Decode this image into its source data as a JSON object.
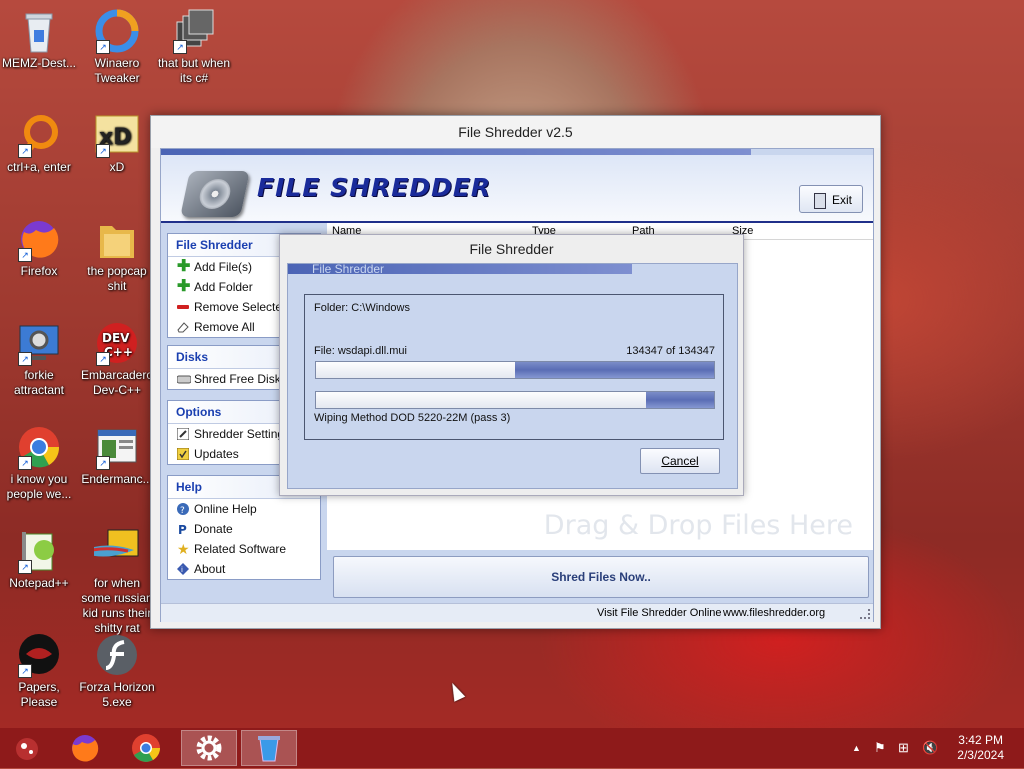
{
  "desktop": {
    "icons": [
      {
        "label": "MEMZ-Dest...",
        "icon": "recycle-bin-icon"
      },
      {
        "label": "Winaero Tweaker",
        "icon": "winaero-icon"
      },
      {
        "label": "that but when its c#",
        "icon": "stacked-windows-icon"
      },
      {
        "label": "ctrl+a, enter",
        "icon": "orange-ring-icon"
      },
      {
        "label": "xD",
        "icon": "hxd-icon"
      },
      {
        "label": "Firefox",
        "icon": "firefox-icon"
      },
      {
        "label": "the popcap shit",
        "icon": "folder-icon"
      },
      {
        "label": "forkie attractant",
        "icon": "monitor-gear-icon"
      },
      {
        "label": "Embarcadero Dev-C++",
        "icon": "devcpp-icon"
      },
      {
        "label": "i know you people we...",
        "icon": "chrome-icon"
      },
      {
        "label": "Endermanc...",
        "icon": "document-window-icon"
      },
      {
        "label": "Notepad++",
        "icon": "notepadpp-icon"
      },
      {
        "label": "for when some russian kid runs their shitty rat",
        "icon": "fish-icon"
      },
      {
        "label": "Papers, Please",
        "icon": "papers-please-icon"
      },
      {
        "label": "Forza Horizon 5.exe",
        "icon": "flash-icon"
      }
    ]
  },
  "main_window": {
    "title": "File Shredder v2.5",
    "old_title": "File Shredder v2.5",
    "logo": "FILE SHREDDER",
    "exit_label": "Exit",
    "sections": [
      {
        "header": "File Shredder",
        "items": [
          {
            "label": "Add File(s)",
            "icon": "plus-icon"
          },
          {
            "label": "Add Folder",
            "icon": "plus-icon"
          },
          {
            "label": "Remove Selected",
            "icon": "minus-icon"
          },
          {
            "label": "Remove All",
            "icon": "eraser-icon"
          }
        ]
      },
      {
        "header": "Disks",
        "items": [
          {
            "label": "Shred Free Disk Space",
            "icon": "disk-icon"
          }
        ]
      },
      {
        "header": "Options",
        "items": [
          {
            "label": "Shredder Settings",
            "icon": "settings-icon"
          },
          {
            "label": "Updates",
            "icon": "updates-icon"
          }
        ]
      },
      {
        "header": "Help",
        "items": [
          {
            "label": "Online Help",
            "icon": "help-icon"
          },
          {
            "label": "Donate",
            "icon": "paypal-icon"
          },
          {
            "label": "Related Software",
            "icon": "star-icon"
          },
          {
            "label": "About",
            "icon": "info-icon"
          }
        ]
      }
    ],
    "columns": [
      "Name",
      "Type",
      "Path",
      "Size"
    ],
    "drag_text": "Drag & Drop Files Here",
    "shred_button": "Shred Files Now..",
    "status_left": "Visit File Shredder Online",
    "status_right": "www.fileshredder.org"
  },
  "progress_dialog": {
    "title": "File Shredder",
    "old_title": "File Shredder",
    "folder": "Folder: C:\\Windows",
    "file": "File: wsdapi.dll.mui",
    "count": "134347  of  134347",
    "progress1_empty_fraction": 0.5,
    "progress2_fill_fraction": 0.17,
    "method": "Wiping Method DOD 5220-22M  (pass 3)",
    "cancel_label": "Cancel"
  },
  "taskbar": {
    "apps": [
      "memz-icon",
      "firefox-icon",
      "chrome-icon",
      "settings-gear-icon",
      "file-shredder-icon"
    ],
    "time": "3:42 PM",
    "date": "2/3/2024"
  }
}
